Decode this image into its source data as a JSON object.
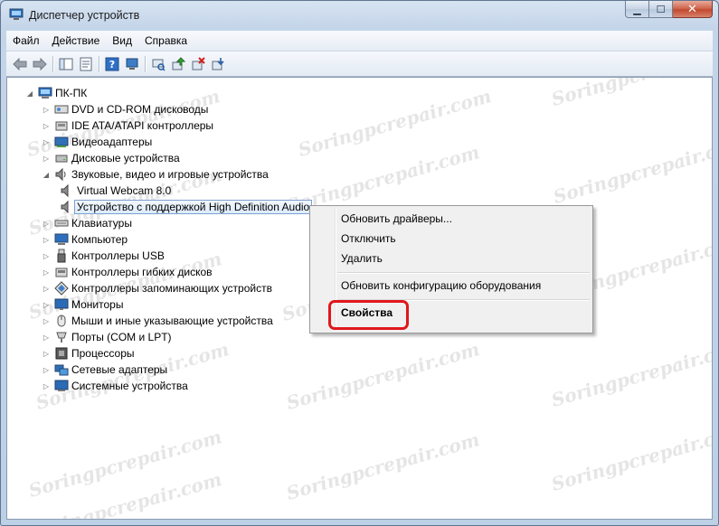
{
  "window": {
    "title": "Диспетчер устройств",
    "controls": {
      "minimize": "▁",
      "maximize": "☐",
      "close": "✕"
    }
  },
  "menu": [
    "Файл",
    "Действие",
    "Вид",
    "Справка"
  ],
  "toolbar": [
    "back-arrow-icon",
    "forward-arrow-icon",
    "console-tree-icon",
    "properties-icon",
    "help-icon",
    "device-manager-icon",
    "scan-hardware-icon",
    "update-driver-icon",
    "uninstall-icon",
    "disable-icon"
  ],
  "tree": {
    "root": "ПК-ПК",
    "items": [
      {
        "label": "DVD и CD-ROM дисководы",
        "icon": "dvd-drive-icon"
      },
      {
        "label": "IDE ATA/ATAPI контроллеры",
        "icon": "ide-controller-icon"
      },
      {
        "label": "Видеоадаптеры",
        "icon": "display-adapter-icon"
      },
      {
        "label": "Дисковые устройства",
        "icon": "disk-drive-icon"
      },
      {
        "label": "Звуковые, видео и игровые устройства",
        "icon": "speaker-icon",
        "expanded": true,
        "children": [
          {
            "label": "Virtual Webcam 8.0",
            "icon": "speaker-icon"
          },
          {
            "label": "Устройство с поддержкой High Definition Audio",
            "icon": "speaker-icon",
            "selected": true
          }
        ]
      },
      {
        "label": "Клавиатуры",
        "icon": "keyboard-icon"
      },
      {
        "label": "Компьютер",
        "icon": "computer-icon"
      },
      {
        "label": "Контроллеры USB",
        "icon": "usb-icon"
      },
      {
        "label": "Контроллеры гибких дисков",
        "icon": "floppy-controller-icon"
      },
      {
        "label": "Контроллеры запоминающих устройств",
        "icon": "storage-controller-icon"
      },
      {
        "label": "Мониторы",
        "icon": "monitor-icon"
      },
      {
        "label": "Мыши и иные указывающие устройства",
        "icon": "mouse-icon"
      },
      {
        "label": "Порты (COM и LPT)",
        "icon": "port-icon"
      },
      {
        "label": "Процессоры",
        "icon": "processor-icon"
      },
      {
        "label": "Сетевые адаптеры",
        "icon": "network-adapter-icon"
      },
      {
        "label": "Системные устройства",
        "icon": "system-device-icon"
      }
    ]
  },
  "context_menu": {
    "update_drivers": "Обновить драйверы...",
    "disable": "Отключить",
    "uninstall": "Удалить",
    "scan": "Обновить конфигурацию оборудования",
    "properties": "Свойства"
  },
  "watermark": "Soringpcrepair.com",
  "colors": {
    "highlight_ring": "#e0161c",
    "selection": "#dcebfc"
  }
}
